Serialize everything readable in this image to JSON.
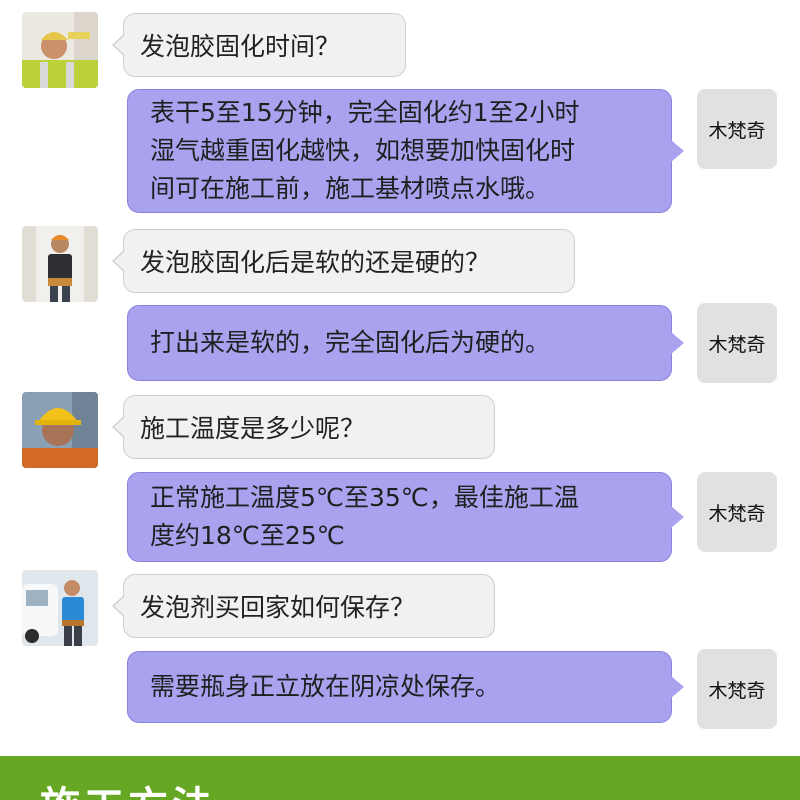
{
  "colors": {
    "answer_bubble": "#a9a3ef",
    "question_bubble": "#f1f1f1",
    "name_box": "#e1e1e1",
    "banner": "#66a824"
  },
  "conversation": [
    {
      "avatar_icon": "worker-with-level-icon",
      "question": "发泡胶固化时间？",
      "answer_lines": [
        "表干5至15分钟，完全固化约1至2小时",
        "湿气越重固化越快，如想要加快固化时",
        "间可在施工前，施工基材喷点水哦。"
      ],
      "responder": "木梵奇"
    },
    {
      "avatar_icon": "worker-with-toolbelt-icon",
      "question": "发泡胶固化后是软的还是硬的？",
      "answer_lines": [
        "打出来是软的，完全固化后为硬的。"
      ],
      "responder": "木梵奇"
    },
    {
      "avatar_icon": "worker-with-hardhat-icon",
      "question": "施工温度是多少呢？",
      "answer_lines": [
        "正常施工温度5℃至35℃，最佳施工温",
        "度约18℃至25℃"
      ],
      "responder": "木梵奇"
    },
    {
      "avatar_icon": "worker-with-van-icon",
      "question": "发泡剂买回家如何保存？",
      "answer_lines": [
        "需要瓶身正立放在阴凉处保存。"
      ],
      "responder": "木梵奇"
    }
  ],
  "banner": {
    "title": "施工方法"
  }
}
